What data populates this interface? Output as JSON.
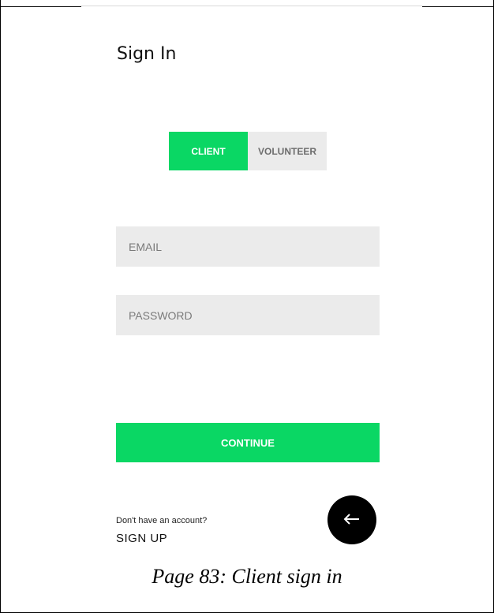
{
  "screen": {
    "title": "Sign In",
    "role_toggle": {
      "options": [
        "CLIENT",
        "VOLUNTEER"
      ],
      "selected": "CLIENT"
    },
    "email_field": {
      "placeholder": "EMAIL",
      "value": ""
    },
    "password_field": {
      "placeholder": "PASSWORD",
      "value": ""
    },
    "continue_label": "CONTINUE",
    "account_prompt": "Don't have an account?",
    "signup_label": "SIGN UP",
    "back_button_icon": "arrow-left-icon"
  },
  "caption": "Page 83: Client sign in",
  "colors": {
    "accent": "#0ad764",
    "field_background": "#ebebeb",
    "back_button": "#000000"
  }
}
